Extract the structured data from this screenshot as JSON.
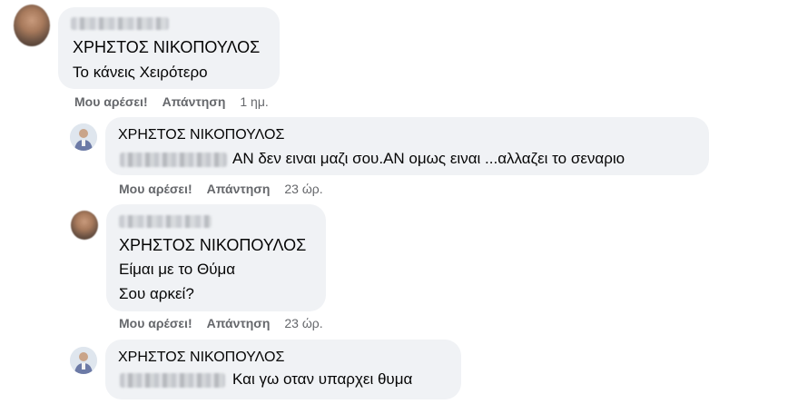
{
  "comments": [
    {
      "author": "ΧΡΗΣΤΟΣ ΝΙΚΟΠΟΥΛΟΣ",
      "lines": [
        "Το κάνεις Χειρότερο"
      ],
      "like_label": "Μου αρέσει!",
      "reply_label": "Απάντηση",
      "time": "1 ημ."
    },
    {
      "author": "ΧΡΗΣΤΟΣ ΝΙΚΟΠΟΥΛΟΣ",
      "lines": [
        "ΑΝ δεν ειναι μαζι σου.ΑΝ ομως ειναι ...αλλαζει το σεναριο"
      ],
      "like_label": "Μου αρέσει!",
      "reply_label": "Απάντηση",
      "time": "23 ώρ."
    },
    {
      "author": "ΧΡΗΣΤΟΣ ΝΙΚΟΠΟΥΛΟΣ",
      "lines": [
        "Είμαι με το Θύμα",
        "Σου αρκεί?"
      ],
      "like_label": "Μου αρέσει!",
      "reply_label": "Απάντηση",
      "time": "23 ώρ."
    },
    {
      "author": "ΧΡΗΣΤΟΣ ΝΙΚΟΠΟΥΛΟΣ",
      "lines": [
        "Και γω οταν υπαρχει θυμα"
      ]
    }
  ]
}
